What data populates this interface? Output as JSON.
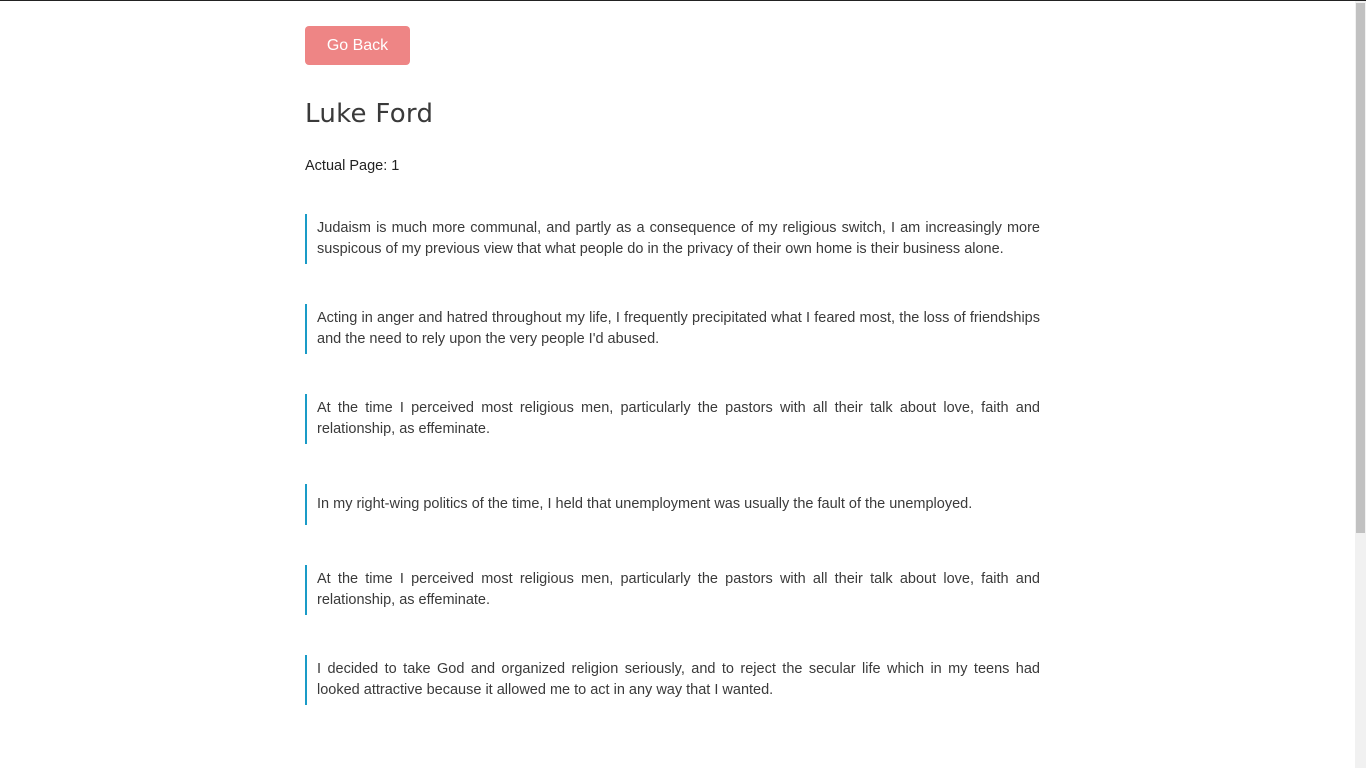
{
  "navigation": {
    "back_label": "Go Back"
  },
  "author": {
    "name": "Luke Ford"
  },
  "pagination": {
    "actual_page_text": "Actual Page: 1"
  },
  "quotes": [
    "Judaism is much more communal, and partly as a consequence of my religious switch, I am increasingly more suspicous of my previous view that what people do in the privacy of their own home is their business alone.",
    "Acting in anger and hatred throughout my life, I frequently precipitated what I feared most, the loss of friendships and the need to rely upon the very people I'd abused.",
    "At the time I perceived most religious men, particularly the pastors with all their talk about love, faith and relationship, as effeminate.",
    "In my right-wing politics of the time, I held that unemployment was usually the fault of the unemployed.",
    "At the time I perceived most religious men, particularly the pastors with all their talk about love, faith and relationship, as effeminate.",
    "I decided to take God and organized religion seriously, and to reject the secular life which in my teens had looked attractive because it allowed me to act in any way that I wanted."
  ],
  "colors": {
    "button_bg": "#ee8585",
    "quote_border": "#1a9bc7",
    "heading_text": "#3a3a3a"
  }
}
